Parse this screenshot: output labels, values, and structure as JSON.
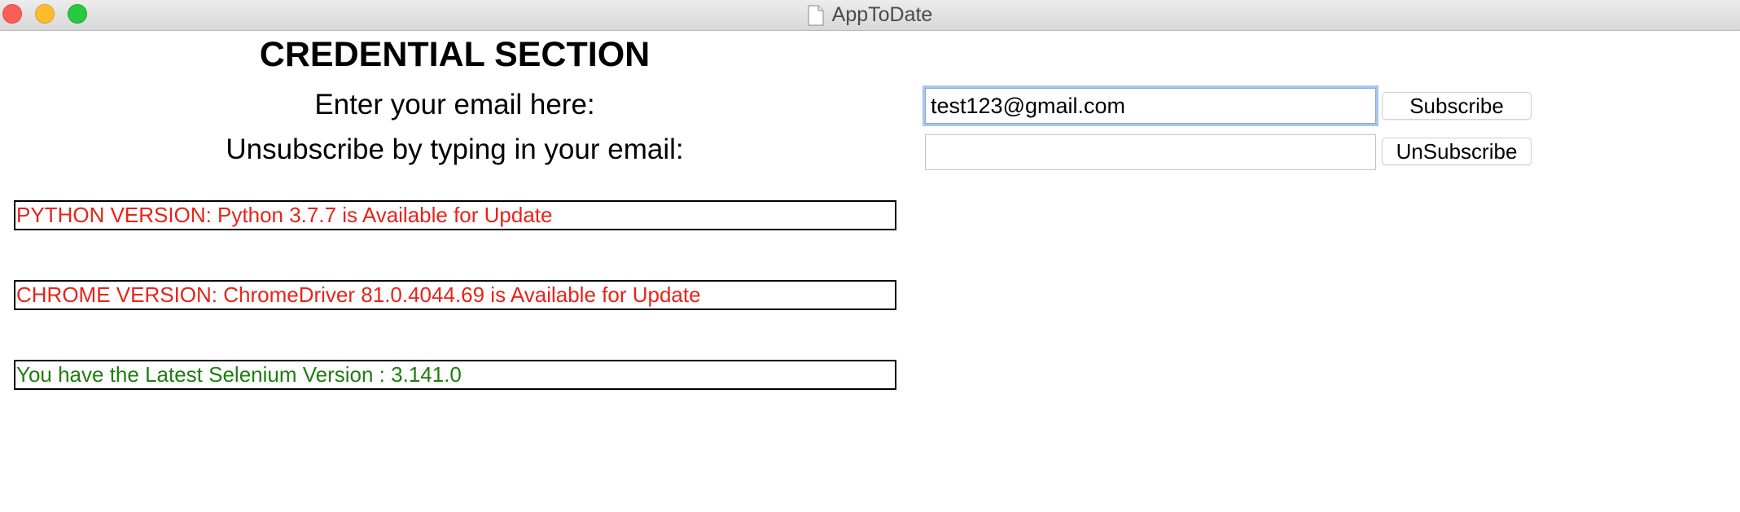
{
  "window": {
    "title": "AppToDate"
  },
  "credential": {
    "heading": "CREDENTIAL SECTION",
    "email_label": "Enter your email here:",
    "email_value": "test123@gmail.com",
    "unsubscribe_label": "Unsubscribe by typing in your email:",
    "unsubscribe_value": "",
    "subscribe_button": "Subscribe",
    "unsubscribe_button": "UnSubscribe"
  },
  "versions": [
    {
      "text": "PYTHON VERSION: Python 3.7.7 is Available for Update",
      "color": "#e8231a"
    },
    {
      "text": "CHROME VERSION: ChromeDriver 81.0.4044.69 is Available for Update",
      "color": "#e8231a"
    },
    {
      "text": "You have the Latest Selenium Version : 3.141.0",
      "color": "#1f7d10"
    }
  ],
  "icons": {
    "close": "close-icon",
    "minimize": "minimize-icon",
    "zoom": "zoom-icon",
    "document": "document-icon"
  }
}
